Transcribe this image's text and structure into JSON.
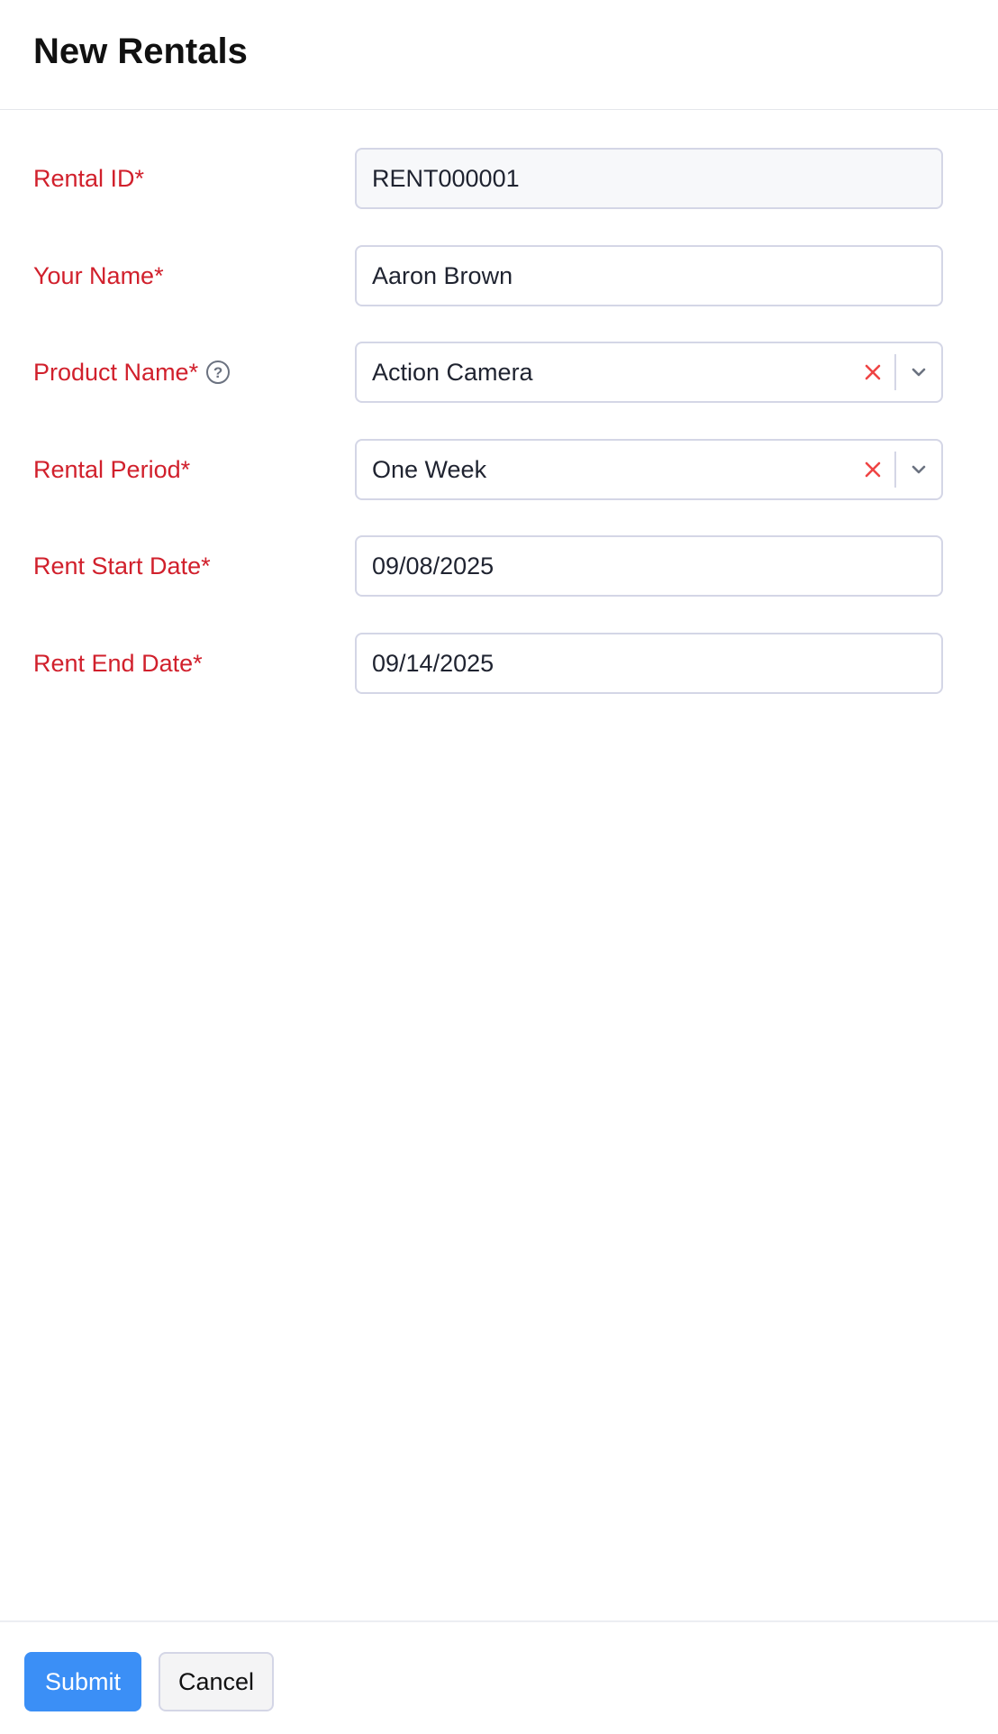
{
  "header": {
    "title": "New Rentals"
  },
  "form": {
    "rental_id": {
      "label": "Rental ID*",
      "value": "RENT000001"
    },
    "your_name": {
      "label": "Your Name*",
      "value": "Aaron Brown"
    },
    "product_name": {
      "label": "Product Name*",
      "help_icon": "?",
      "value": "Action Camera"
    },
    "rental_period": {
      "label": "Rental Period*",
      "value": "One Week"
    },
    "rent_start_date": {
      "label": "Rent Start Date*",
      "value": "09/08/2025"
    },
    "rent_end_date": {
      "label": "Rent End Date*",
      "value": "09/14/2025"
    }
  },
  "footer": {
    "submit_label": "Submit",
    "cancel_label": "Cancel"
  },
  "colors": {
    "label_required": "#d1202c",
    "clear_icon": "#ef4444",
    "submit_bg": "#3b8ff6",
    "border": "#d4d6e6"
  }
}
